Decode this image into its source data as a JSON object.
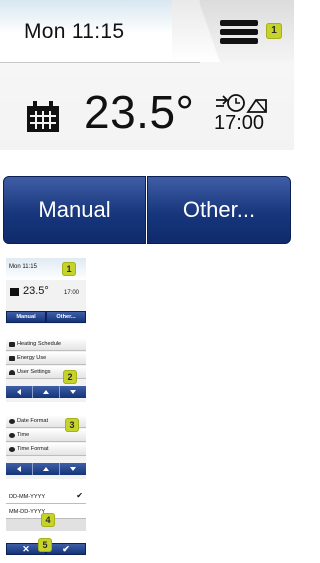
{
  "main_screen": {
    "time": "Mon 11:15",
    "temperature": "23.5°",
    "schedule_time": "17:00",
    "buttons": {
      "manual": "Manual",
      "other": "Other..."
    },
    "badge": "1"
  },
  "mini_home": {
    "time": "Mon 11:15",
    "temperature": "23.5°",
    "schedule_time": "17:00",
    "buttons": {
      "manual": "Manual",
      "other": "Other..."
    },
    "badge": "1"
  },
  "menu_list": {
    "items": [
      "Heating Schedule",
      "Energy Use",
      "User Settings"
    ],
    "badge": "2"
  },
  "user_settings_list": {
    "items": [
      "Date Format",
      "Time",
      "Time Format"
    ],
    "badge": "3"
  },
  "date_format_list": {
    "options": [
      "DD-MM-YYYY",
      "MM-DD-YYYY"
    ],
    "selected": "DD-MM-YYYY",
    "badge_option": "4",
    "badge_confirm": "5"
  },
  "icons": [
    "menu-icon",
    "calendar-icon",
    "schedule-clock-icon",
    "check-icon",
    "close-icon",
    "arrow-left-icon",
    "arrow-up-icon",
    "arrow-down-icon"
  ],
  "colors": {
    "button_blue": "#17367c",
    "badge_green": "#c6d32a"
  }
}
